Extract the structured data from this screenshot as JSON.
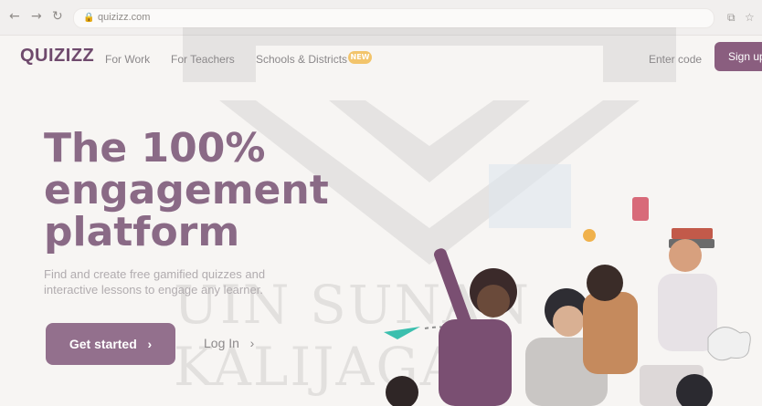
{
  "browser": {
    "url": "quizizz.com",
    "icons": [
      "back-arrow-icon",
      "forward-arrow-icon",
      "reload-icon",
      "lock-icon",
      "extension-icon",
      "bookmark-star-icon"
    ]
  },
  "header": {
    "logo": "QUIZIZZ",
    "nav": [
      "For Work",
      "For Teachers",
      "Schools & Districts"
    ],
    "new_badge": "NEW",
    "enter_code": "Enter code",
    "signup": "Sign up"
  },
  "hero": {
    "title_lines": [
      "The 100%",
      "engagement",
      "platform"
    ],
    "subtitle_lines": [
      "Find and create free gamified quizzes and",
      "interactive lessons to engage any learner."
    ],
    "primary_cta": "Get started",
    "secondary_cta": "Log In"
  },
  "watermark": {
    "text": "UIN SUNAN KALIJAGA"
  },
  "colors": {
    "brand": "#8a5e7f",
    "title": "#8a6a86",
    "badge": "#f2c46b",
    "background": "#f7f5f3"
  }
}
